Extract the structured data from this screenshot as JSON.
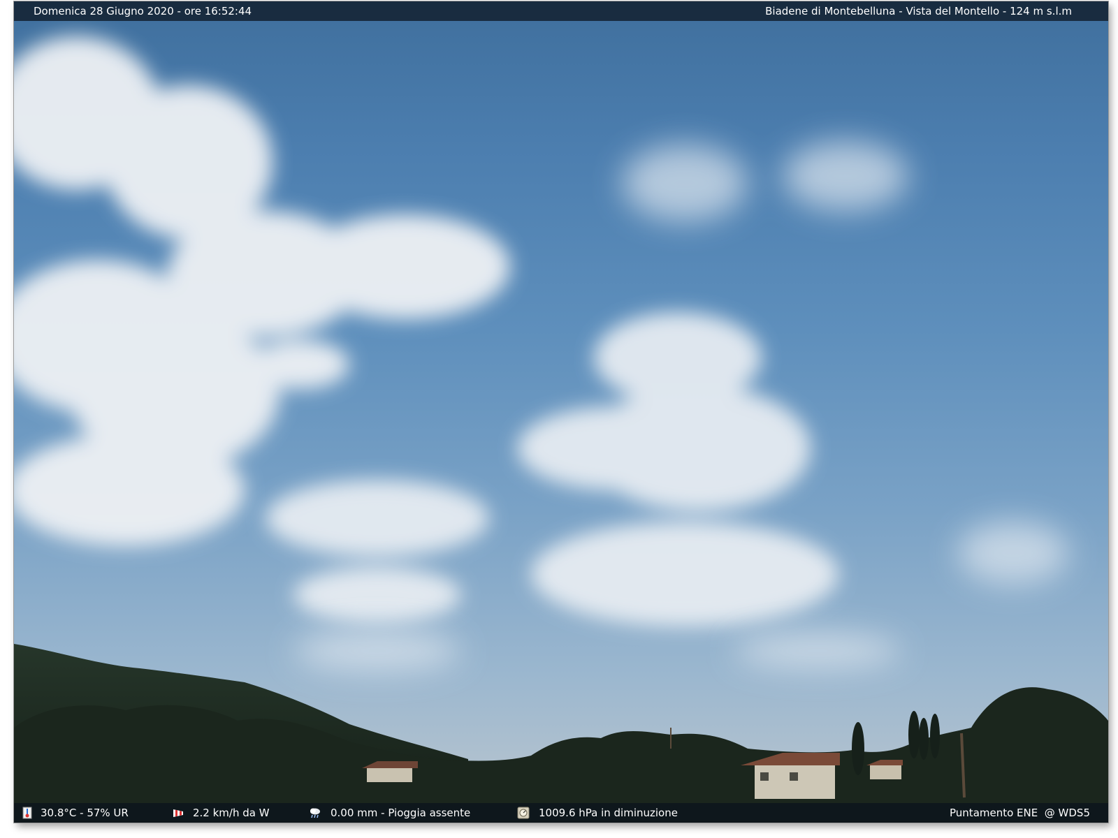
{
  "header": {
    "datetime": "Domenica 28 Giugno 2020 - ore 16:52:44",
    "location": "Biadene di Montebelluna - Vista del Montello - 124 m s.l.m"
  },
  "footer": {
    "temperature_humidity": "30.8°C - 57% UR",
    "wind": "2.2 km/h da W",
    "rain": "0.00 mm - Pioggia assente",
    "pressure": "1009.6 hPa in diminuzione",
    "pointing": "Puntamento ENE  @ WDS5"
  },
  "icons": {
    "temperature": "thermometer-icon",
    "wind": "windsock-icon",
    "rain": "rain-cloud-icon",
    "pressure": "barometer-icon"
  },
  "colors": {
    "sky_top": "#3f6f9d",
    "sky_bottom": "#b6c2cb",
    "bar_background": "#0a121c",
    "bar_text": "#ffffff",
    "hill": "#1c2a1e"
  }
}
